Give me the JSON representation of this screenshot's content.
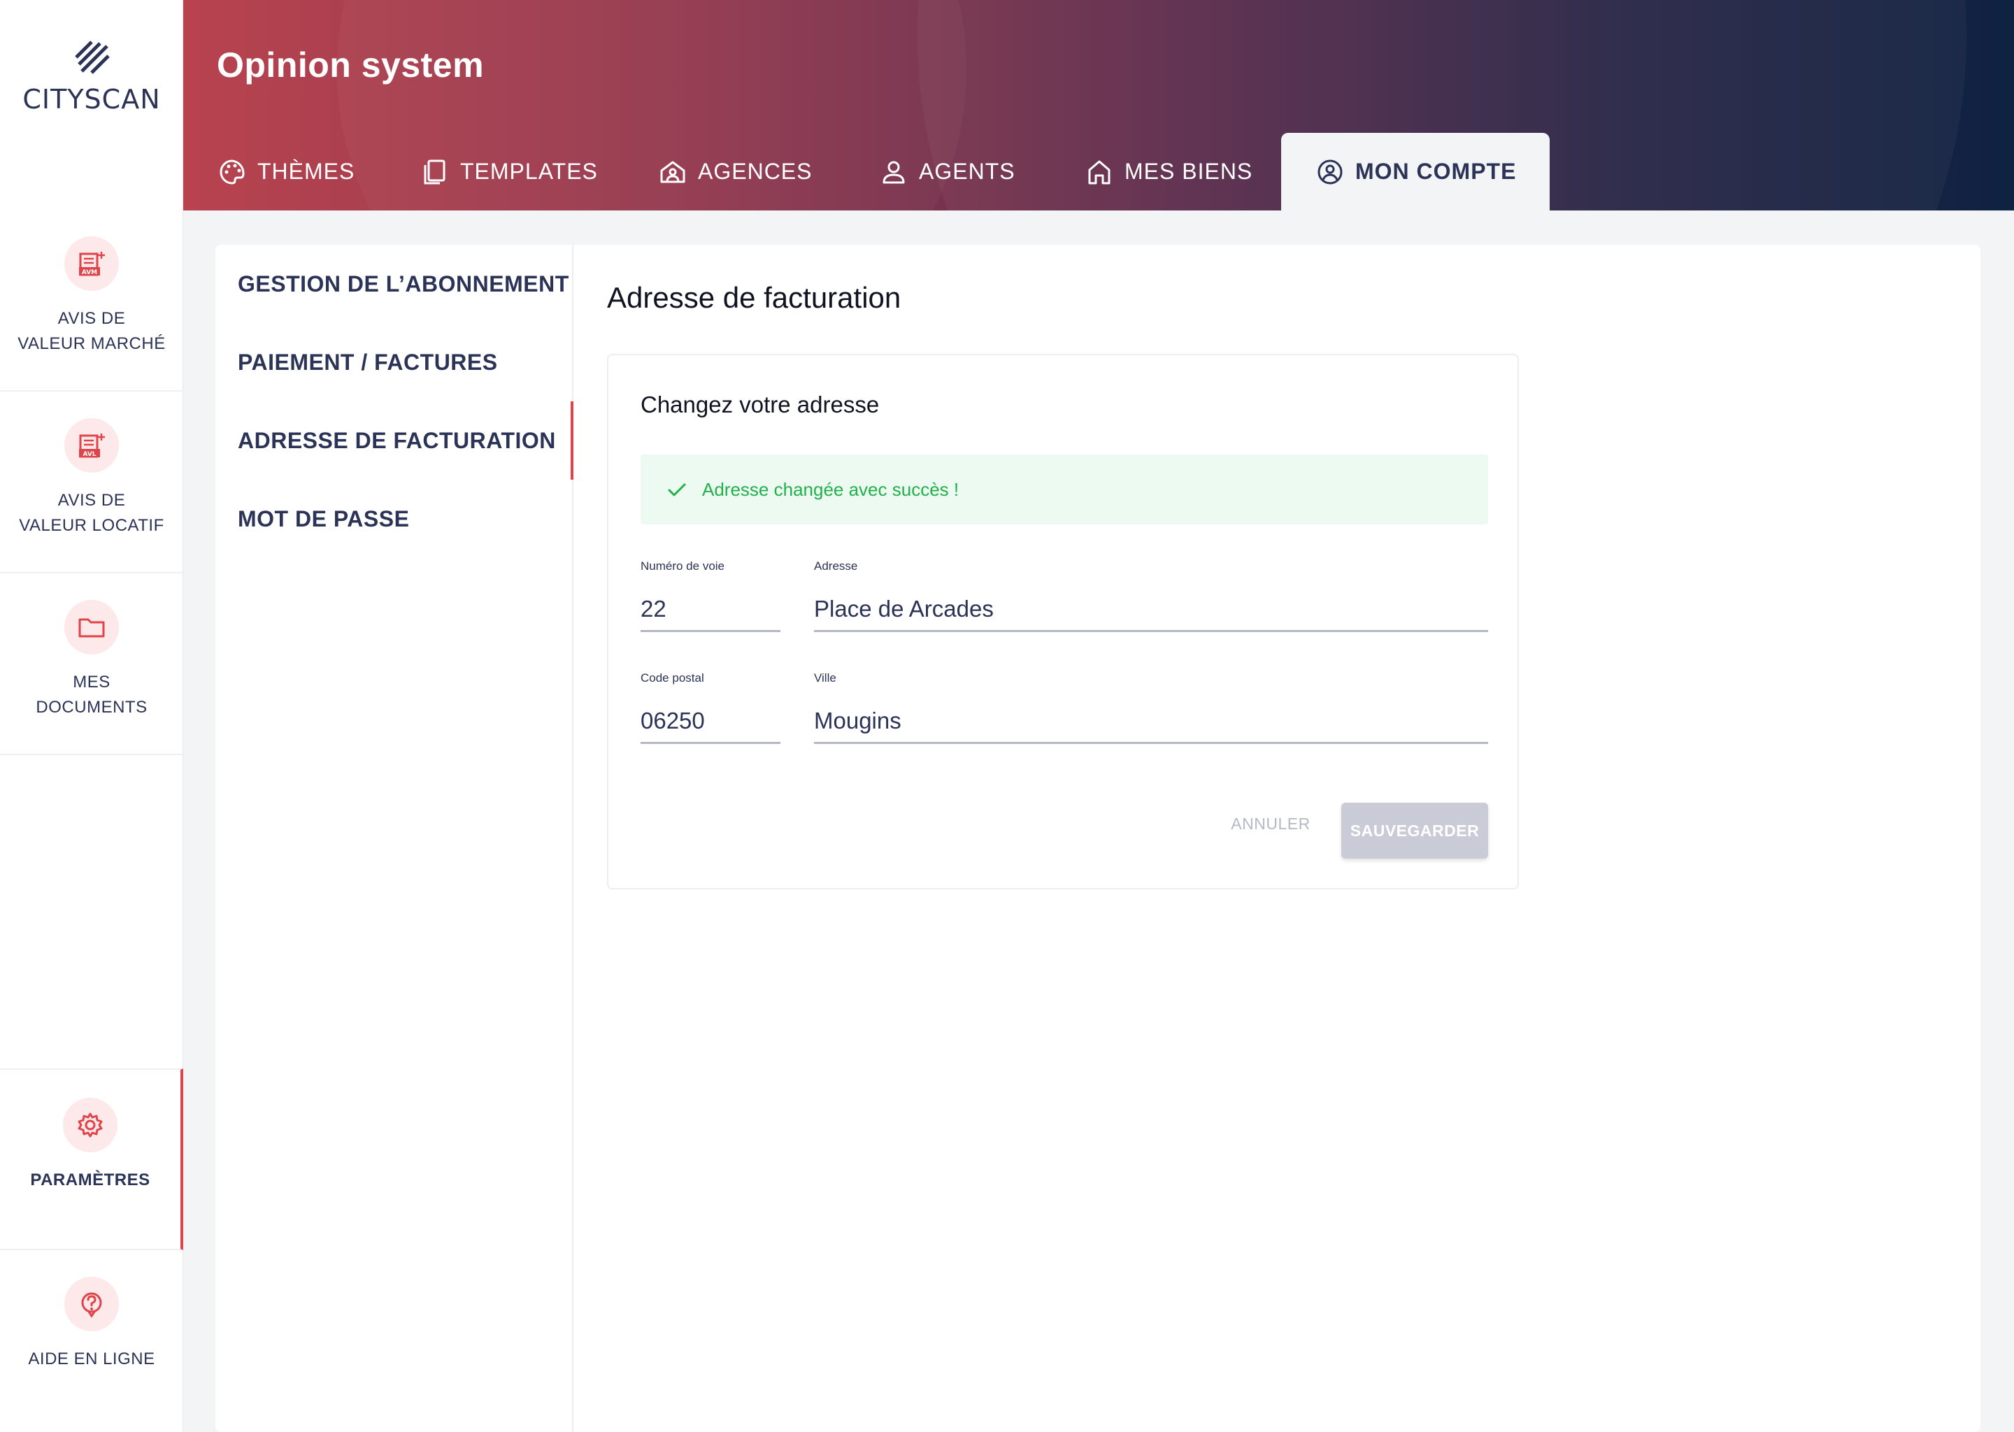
{
  "brand": {
    "logo_text": "CITYSCAN",
    "accent": "#e0444b",
    "navy": "#2b3357"
  },
  "rail": {
    "items": [
      {
        "label": "AVIS DE\nVALEUR MARCHÉ",
        "icon": "avm-document-icon"
      },
      {
        "label": "AVIS DE\nVALEUR LOCATIF",
        "icon": "avl-document-icon"
      },
      {
        "label": "MES\nDOCUMENTS",
        "icon": "folder-icon"
      },
      {
        "label": "PARAMÈTRES",
        "icon": "gear-icon",
        "active": true
      },
      {
        "label": "AIDE EN LIGNE",
        "icon": "help-icon"
      }
    ]
  },
  "header": {
    "title": "Opinion system",
    "tabs": [
      {
        "label": "THÈMES",
        "icon": "palette-icon"
      },
      {
        "label": "TEMPLATES",
        "icon": "copy-icon"
      },
      {
        "label": "AGENCES",
        "icon": "agency-icon"
      },
      {
        "label": "AGENTS",
        "icon": "user-icon"
      },
      {
        "label": "MES BIENS",
        "icon": "home-icon"
      },
      {
        "label": "MON COMPTE",
        "icon": "account-icon",
        "active": true
      }
    ]
  },
  "subnav": {
    "items": [
      {
        "label": "GESTION DE L’ABONNEMENT"
      },
      {
        "label": "PAIEMENT / FACTURES"
      },
      {
        "label": "ADRESSE DE FACTURATION",
        "active": true
      },
      {
        "label": "MOT DE PASSE"
      }
    ]
  },
  "main": {
    "title": "Adresse de facturation",
    "card": {
      "title": "Changez votre adresse",
      "alert": "Adresse changée avec succès !",
      "fields": {
        "numero": {
          "label": "Numéro de voie",
          "value": "22"
        },
        "adresse": {
          "label": "Adresse",
          "value": "Place de Arcades"
        },
        "code_postal": {
          "label": "Code postal",
          "value": "06250"
        },
        "ville": {
          "label": "Ville",
          "value": "Mougins"
        }
      },
      "cancel_label": "ANNULER",
      "save_label": "SAUVEGARDER"
    }
  }
}
